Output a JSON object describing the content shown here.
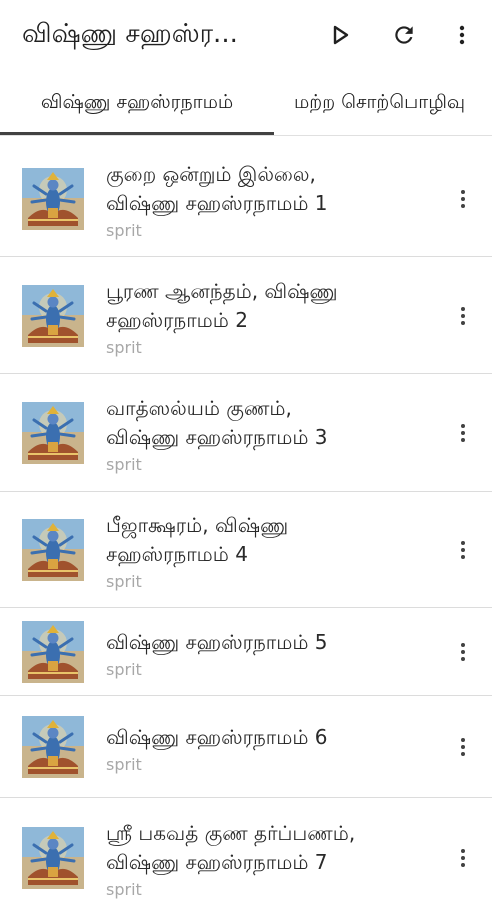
{
  "app": {
    "title": "விஷ்ணு சஹஸ்ர...",
    "icons": {
      "play": "play-icon",
      "refresh": "refresh-icon",
      "menu": "more-vert-icon"
    }
  },
  "tabs": [
    {
      "label": "விஷ்ணு சஹஸ்ரநாமம்",
      "selected": true
    },
    {
      "label": "மற்ற சொற்பொழிவு",
      "selected": false
    }
  ],
  "colors": {
    "accent_indicator": "#424242",
    "subtitle": "#a8a8a8",
    "divider": "#dcdcdc"
  },
  "items": [
    {
      "line1": "குறை ஒன்றும் இல்லை,",
      "line2": "விஷ்ணு சஹஸ்ரநாமம் 1",
      "subtitle": "sprit"
    },
    {
      "line1": "பூரண ஆனந்தம், விஷ்ணு",
      "line2": "சஹஸ்ரநாமம் 2",
      "subtitle": "sprit"
    },
    {
      "line1": "வாத்ஸல்யம் குணம்,",
      "line2": "விஷ்ணு சஹஸ்ரநாமம் 3",
      "subtitle": "sprit"
    },
    {
      "line1": "பீஜாக்ஷரம், விஷ்ணு",
      "line2": "சஹஸ்ரநாமம் 4",
      "subtitle": "sprit"
    },
    {
      "line1": "விஷ்ணு சஹஸ்ரநாமம் 5",
      "line2": "",
      "subtitle": "sprit"
    },
    {
      "line1": "விஷ்ணு சஹஸ்ரநாமம் 6",
      "line2": "",
      "subtitle": "sprit"
    },
    {
      "line1": "ஸ்ரீ பகவத் குண தர்ப்பணம்,",
      "line2": "விஷ்ணு சஹஸ்ரநாமம் 7",
      "subtitle": "sprit"
    }
  ]
}
